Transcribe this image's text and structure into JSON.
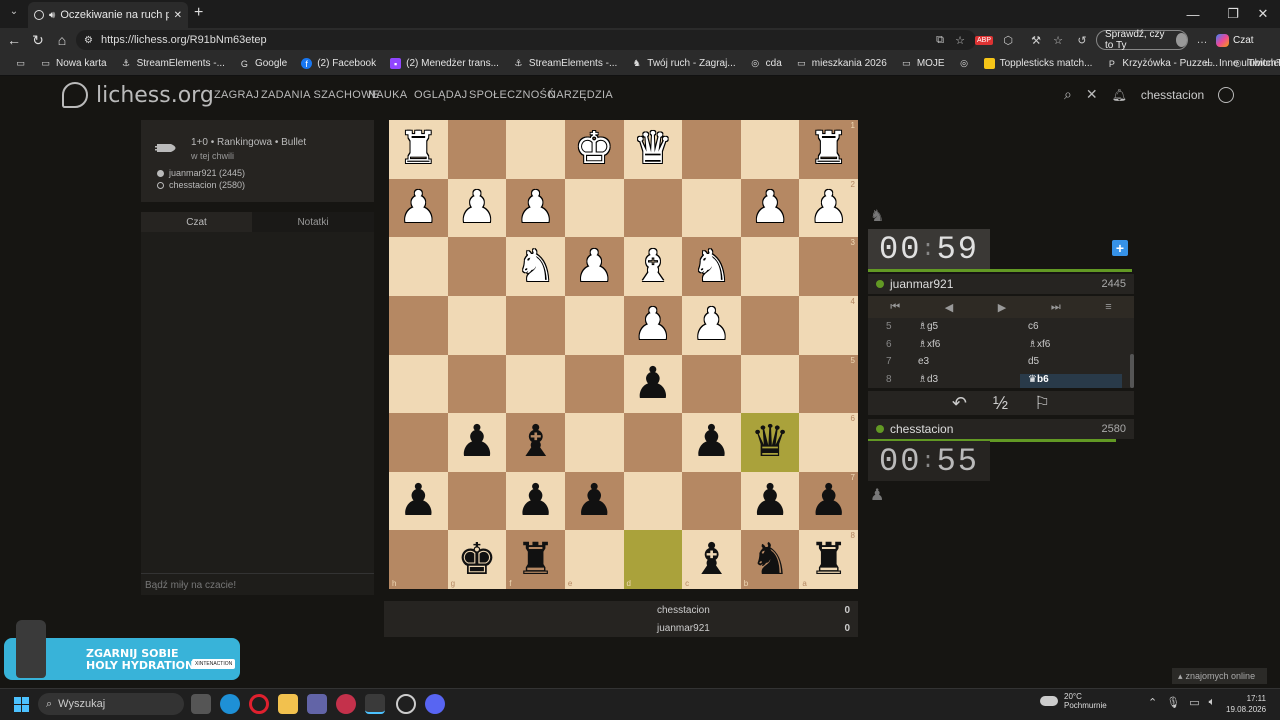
{
  "browser": {
    "tab_title": "Oczekiwanie na ruch przeciwni",
    "url": "https://lichess.org/R91bNm63etep",
    "profile_button": "Sprawdź, czy to Ty",
    "copilot_label": "Czat",
    "new_tab_symbol": "+",
    "window_controls": [
      "—",
      "❐",
      "✕"
    ],
    "bookmarks": [
      {
        "label": "Nowa karta",
        "icon": "tab-icon"
      },
      {
        "label": "StreamElements -...",
        "icon": "anchor-icon"
      },
      {
        "label": "Google",
        "icon": "google-icon"
      },
      {
        "label": "(2) Facebook",
        "icon": "facebook-icon"
      },
      {
        "label": "(2) Menedżer trans...",
        "icon": "twitch-icon"
      },
      {
        "label": "StreamElements -...",
        "icon": "anchor-icon"
      },
      {
        "label": "Twój ruch - Zagraj...",
        "icon": "lichess-icon"
      },
      {
        "label": "cda",
        "icon": "globe-icon"
      },
      {
        "label": "mieszkania 2026",
        "icon": "folder-icon"
      },
      {
        "label": "MOJE",
        "icon": "folder-icon"
      },
      {
        "label": "",
        "icon": "globe-icon"
      },
      {
        "label": "Topplesticks match...",
        "icon": "note-icon"
      },
      {
        "label": "Krzyżówka - Puzzel...",
        "icon": "puzzle-icon"
      },
      {
        "label": "TwitchTCG",
        "icon": "globe-icon"
      }
    ],
    "other_bookmarks": "Inne ulubione"
  },
  "site": {
    "logo": "lichess.org",
    "nav": [
      "ZAGRAJ",
      "ZADANIA SZACHOWE",
      "NAUKA",
      "OGLĄDAJ",
      "SPOŁECZNOŚĆ",
      "NARZĘDZIA"
    ],
    "username": "chesstacion"
  },
  "game_info": {
    "mode": "1+0 • Rankingowa • Bullet",
    "when": "w tej chwili",
    "white_player": "juanmar921 (2445)",
    "black_player": "chesstacion (2580)"
  },
  "chat": {
    "tab_chat": "Czat",
    "tab_notes": "Notatki",
    "placeholder": "Bądź miły na czacie!"
  },
  "board": {
    "orientation": "black",
    "highlight_squares": [
      "d8",
      "b6"
    ],
    "rows": [
      [
        "R",
        "",
        "",
        "K",
        "Q",
        "",
        "",
        "R"
      ],
      [
        "P",
        "P",
        "P",
        "",
        "",
        "",
        "P",
        "P"
      ],
      [
        "",
        "",
        "N",
        "P",
        "B",
        "N",
        "",
        ""
      ],
      [
        "",
        "",
        "",
        "",
        "P",
        "P",
        "",
        ""
      ],
      [
        "",
        "",
        "",
        "",
        "p",
        "",
        "",
        ""
      ],
      [
        "",
        "p",
        "b",
        "",
        "",
        "p",
        "q",
        ""
      ],
      [
        "p",
        "",
        "p",
        "p",
        "",
        "",
        "p",
        "p"
      ],
      [
        "",
        "k",
        "r",
        "",
        "",
        "b",
        "n",
        "r"
      ]
    ],
    "rank_labels": [
      "1",
      "2",
      "3",
      "4",
      "5",
      "6",
      "7",
      "8"
    ],
    "file_labels": [
      "h",
      "g",
      "f",
      "e",
      "d",
      "c",
      "b",
      "a"
    ]
  },
  "score": [
    {
      "name": "chesstacion",
      "points": "0"
    },
    {
      "name": "juanmar921",
      "points": "0"
    }
  ],
  "clocks": {
    "top": {
      "min": "00",
      "sec": "59"
    },
    "bottom": {
      "min": "00",
      "sec": "55"
    }
  },
  "players": {
    "top": {
      "name": "juanmar921",
      "rating": "2445"
    },
    "bottom": {
      "name": "chesstacion",
      "rating": "2580"
    }
  },
  "moves": [
    {
      "n": "5",
      "w": "♗g5",
      "b": "c6"
    },
    {
      "n": "6",
      "w": "♗xf6",
      "b": "♗xf6"
    },
    {
      "n": "7",
      "w": "e3",
      "b": "d5"
    },
    {
      "n": "8",
      "w": "♗d3",
      "b": "♛b6"
    }
  ],
  "controls": [
    "⏮",
    "◀",
    "▶",
    "⏭",
    "≡"
  ],
  "actions": [
    "↶",
    "½",
    "⚐"
  ],
  "friends_online": "znajomych online",
  "ad": {
    "line1": "ZGARNIJ SOBIE",
    "line2": "HOLY HYDRATION",
    "badge": "XINTENACTION"
  },
  "taskbar": {
    "search": "Wyszukaj",
    "weather_temp": "20°C",
    "weather_desc": "Pochmurnie",
    "time": "17:11",
    "date": "19.08.2026"
  },
  "colors": {
    "accent_green": "#629924",
    "board_light": "#f0d9b5",
    "board_dark": "#b58863",
    "highlight": "#cdd16a"
  }
}
